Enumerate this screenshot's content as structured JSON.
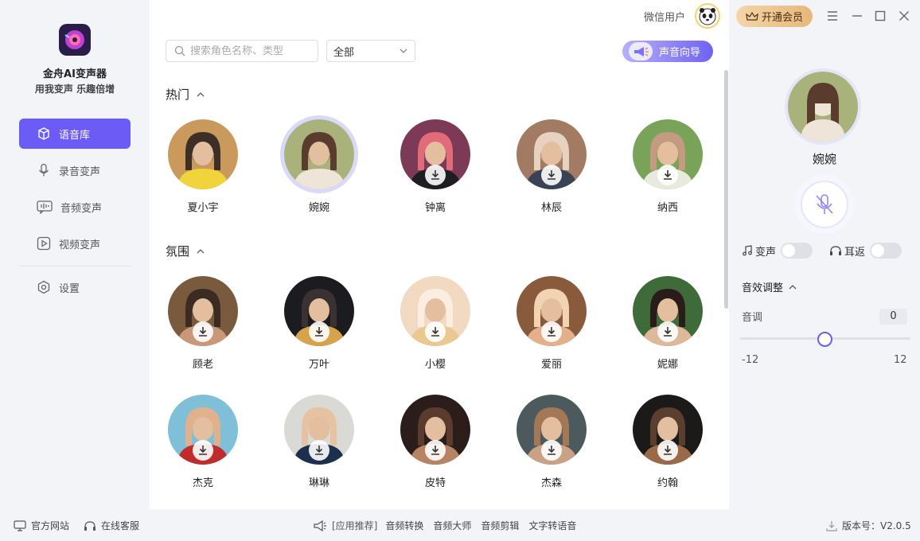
{
  "app": {
    "name": "金舟AI变声器",
    "slogan": "用我变声 乐趣倍增"
  },
  "sidebar": {
    "items": [
      {
        "label": "语音库",
        "icon": "cube-icon",
        "active": true
      },
      {
        "label": "录音变声",
        "icon": "microphone-icon"
      },
      {
        "label": "音频变声",
        "icon": "waveform-icon"
      },
      {
        "label": "视频变声",
        "icon": "play-icon"
      },
      {
        "label": "设置",
        "icon": "settings-icon"
      }
    ]
  },
  "header": {
    "user": "微信用户",
    "vip": "开通会员"
  },
  "search": {
    "placeholder": "搜索角色名称、类型"
  },
  "filter": {
    "selected": "全部"
  },
  "guide": {
    "label": "声音向导"
  },
  "sections": [
    {
      "title": "热门",
      "voices": [
        {
          "name": "夏小宇",
          "downloaded": true,
          "palette": [
            "#c99a5c",
            "#f1d33c",
            "#3d2f26"
          ]
        },
        {
          "name": "婉婉",
          "downloaded": true,
          "selected": true,
          "palette": [
            "#a8b27a",
            "#eee4d8",
            "#5a3c2e"
          ]
        },
        {
          "name": "钟离",
          "downloaded": false,
          "palette": [
            "#7d3a56",
            "#1d1d22",
            "#e16b78"
          ]
        },
        {
          "name": "林辰",
          "downloaded": false,
          "palette": [
            "#a27b62",
            "#3a4355",
            "#e7d2c1"
          ]
        },
        {
          "name": "纳西",
          "downloaded": false,
          "palette": [
            "#7aa35a",
            "#e8eadd",
            "#c49a80"
          ]
        }
      ]
    },
    {
      "title": "氛围",
      "voices": [
        {
          "name": "顾老",
          "downloaded": false,
          "palette": [
            "#7a5a3c",
            "#c99878",
            "#3b2b22"
          ]
        },
        {
          "name": "万叶",
          "downloaded": false,
          "palette": [
            "#1c1b1f",
            "#d6a24a",
            "#3a3232"
          ]
        },
        {
          "name": "小樱",
          "downloaded": false,
          "palette": [
            "#f1d9c2",
            "#e9c98f",
            "#fbeee0"
          ]
        },
        {
          "name": "爱丽",
          "downloaded": false,
          "palette": [
            "#8a5a3c",
            "#e4b08b",
            "#f0d4b3"
          ]
        },
        {
          "name": "妮娜",
          "downloaded": false,
          "palette": [
            "#3f6a3a",
            "#ddb899",
            "#2a1c18"
          ]
        }
      ]
    },
    {
      "title": "",
      "voices": [
        {
          "name": "杰克",
          "downloaded": false,
          "palette": [
            "#7fc0d8",
            "#c02b2b",
            "#e0b18b"
          ]
        },
        {
          "name": "琳琳",
          "downloaded": false,
          "palette": [
            "#d9d9d6",
            "#1c2f4d",
            "#e6c2a2"
          ]
        },
        {
          "name": "皮特",
          "downloaded": false,
          "palette": [
            "#2b1e1a",
            "#b78463",
            "#5a3b2d"
          ]
        },
        {
          "name": "杰森",
          "downloaded": false,
          "palette": [
            "#4c5a5e",
            "#caa184",
            "#a27856"
          ]
        },
        {
          "name": "约翰",
          "downloaded": false,
          "palette": [
            "#1b1a18",
            "#9a6a48",
            "#5a3f2f"
          ]
        }
      ]
    }
  ],
  "panel": {
    "selected_name": "婉婉",
    "toggle_voice": "变声",
    "toggle_monitor": "耳返",
    "eq_title": "音效调整",
    "pitch_label": "音调",
    "pitch_value": "0",
    "pitch_min": "-12",
    "pitch_max": "12",
    "pitch_level": 0.5
  },
  "footer": {
    "left": [
      {
        "label": "官方网站"
      },
      {
        "label": "在线客服"
      }
    ],
    "promo": "[应用推荐]",
    "apps": [
      "音频转换",
      "音频大师",
      "音频剪辑",
      "文字转语音"
    ],
    "version": "版本号：V2.0.5"
  },
  "colors": {
    "accent": "#6a5cf5",
    "vip": "#e7b77c"
  }
}
